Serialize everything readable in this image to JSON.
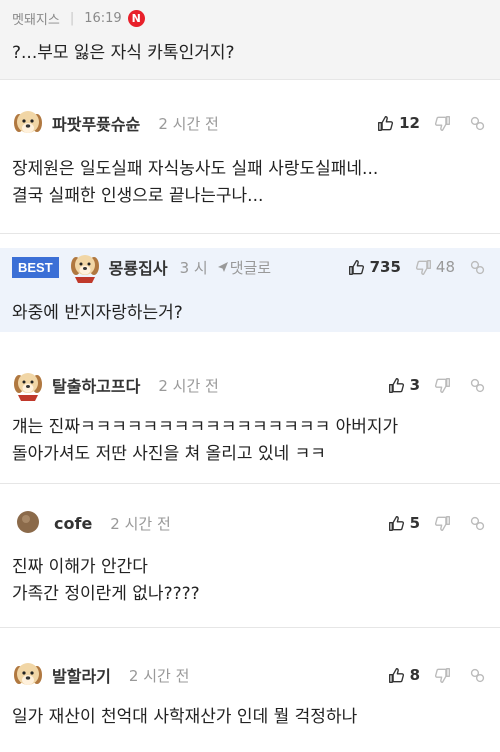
{
  "top": {
    "author": "멧돼지스",
    "time": "16:19",
    "badge": "N",
    "text": "?...부모 잃은 자식 카톡인거지?"
  },
  "comments": [
    {
      "nickname": "파팟푸퓻슈슌",
      "time": "2 시간 전",
      "upvotes": "12",
      "downvotes": "",
      "lines": [
        "장제원은 일도실패 자식농사도 실패 사랑도실패네...",
        "결국 실패한 인생으로 끝나는구나..."
      ]
    },
    {
      "best_label": "BEST",
      "nickname": "몽룡집사",
      "time": "3 시",
      "reply_label": "댓글로",
      "upvotes": "735",
      "downvotes": "48",
      "lines": [
        "와중에 반지자랑하는거?"
      ]
    },
    {
      "nickname": "탈출하고프다",
      "time": "2 시간 전",
      "upvotes": "3",
      "downvotes": "",
      "lines": [
        "걔는 진짜ㅋㅋㅋㅋㅋㅋㅋㅋㅋㅋㅋㅋㅋㅋㅋㅋ 아버지가",
        "돌아가셔도 저딴 사진을 쳐 올리고 있네 ㅋㅋ"
      ]
    },
    {
      "nickname": "cofe",
      "time": "2 시간 전",
      "upvotes": "5",
      "downvotes": "",
      "lines": [
        "진짜 이해가 안간다",
        "가족간 정이란게 없나????"
      ]
    },
    {
      "nickname": "발할라기",
      "time": "2 시간 전",
      "upvotes": "8",
      "downvotes": "",
      "lines": [
        "일가 재산이 천억대 사학재산가 인데 뭘 걱정하나"
      ]
    }
  ],
  "icons": {
    "upvote": "thumbs-up-icon",
    "downvote": "thumbs-down-icon",
    "share": "link-icon",
    "reply": "reply-arrow-icon",
    "avatar_dog": "puppy-avatar",
    "avatar_circle": "brown-circle-avatar"
  },
  "colors": {
    "best_badge": "#3b6fd6",
    "best_background": "#eef3fb",
    "new_badge": "#e8202a"
  }
}
